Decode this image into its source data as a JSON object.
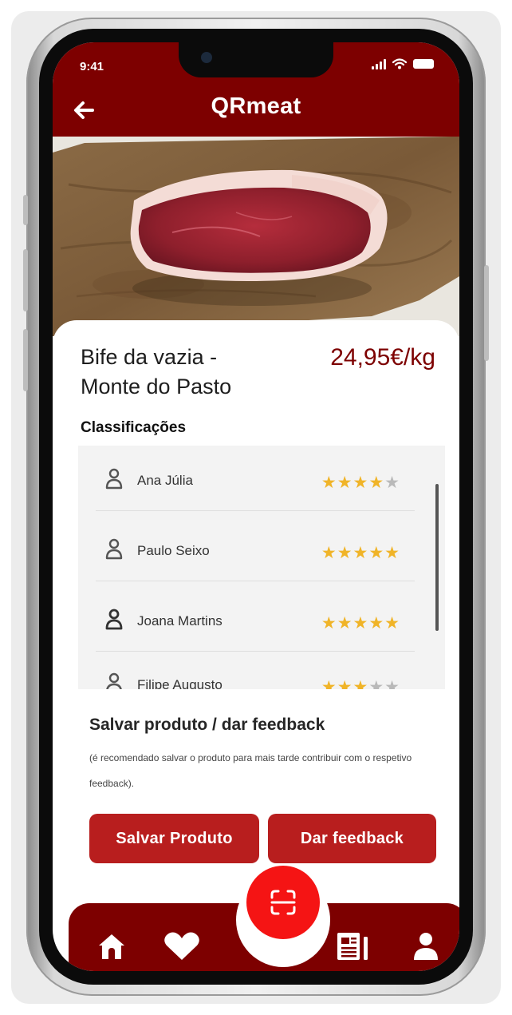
{
  "status_bar": {
    "time": "9:41"
  },
  "header": {
    "title": "QRmeat"
  },
  "product": {
    "name": "Bife da vazia - Monte do Pasto",
    "price": "24,95€/kg"
  },
  "ratings": {
    "section_title": "Classificações",
    "items": [
      {
        "user": "Ana Júlia",
        "stars": 4,
        "max_stars": 5
      },
      {
        "user": "Paulo Seixo",
        "stars": 5,
        "max_stars": 5
      },
      {
        "user": "Joana Martins",
        "stars": 5,
        "max_stars": 5
      },
      {
        "user": "Filipe Augusto",
        "stars": 3,
        "max_stars": 5
      }
    ]
  },
  "save_section": {
    "title": "Salvar produto / dar feedback",
    "hint": "(é recomendado salvar o produto para mais tarde contribuir com o respetivo feedback).",
    "save_button": "Salvar Produto",
    "feedback_button": "Dar feedback"
  },
  "colors": {
    "brand": "#7d0000",
    "button": "#b81e1e",
    "scan": "#f51414",
    "star": "#f0b428"
  },
  "nav": {
    "items": [
      "home-icon",
      "heart-icon",
      "scan-icon",
      "news-icon",
      "profile-icon"
    ]
  }
}
